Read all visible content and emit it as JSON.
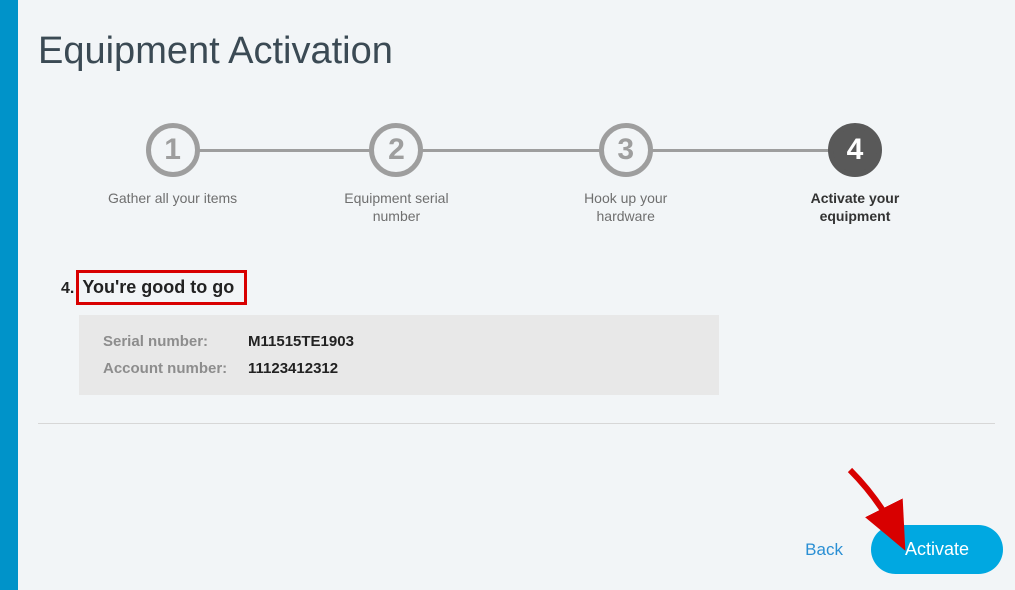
{
  "page_title": "Equipment Activation",
  "steps": [
    {
      "num": "1",
      "label": "Gather all your items",
      "active": false
    },
    {
      "num": "2",
      "label": "Equipment serial number",
      "active": false
    },
    {
      "num": "3",
      "label": "Hook up your hardware",
      "active": false
    },
    {
      "num": "4",
      "label": "Activate your equipment",
      "active": true
    }
  ],
  "section": {
    "number": "4.",
    "heading": "You're good to go"
  },
  "info": {
    "serial_label": "Serial number:",
    "serial_value": "M11515TE1903",
    "account_label": "Account number:",
    "account_value": "11123412312"
  },
  "actions": {
    "back": "Back",
    "activate": "Activate"
  }
}
